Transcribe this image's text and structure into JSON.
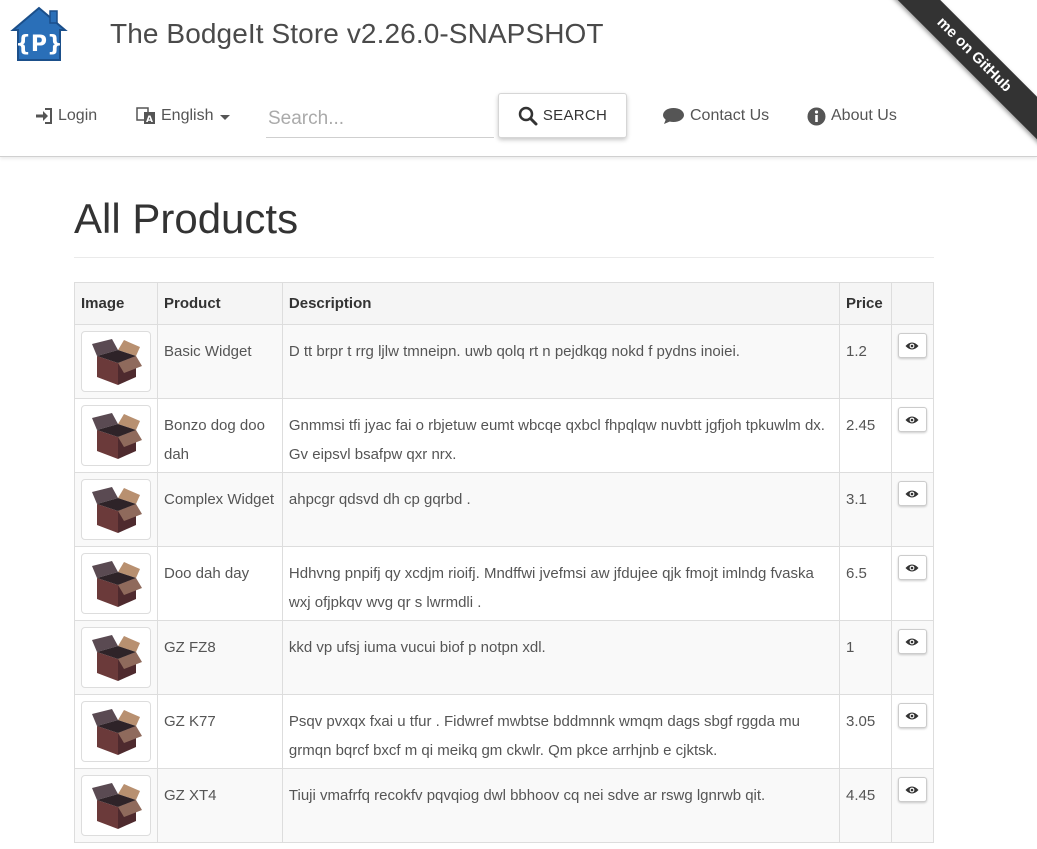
{
  "header": {
    "brand": "The BodgeIt Store v2.26.0-SNAPSHOT",
    "login_label": "Login",
    "language_label": "English",
    "search_placeholder": "Search...",
    "search_button_label": "SEARCH",
    "contact_label": "Contact Us",
    "about_label": "About Us",
    "ribbon_text": "me on GitHub"
  },
  "main": {
    "title": "All Products",
    "columns": [
      "Image",
      "Product",
      "Description",
      "Price",
      ""
    ],
    "products": [
      {
        "name": "Basic Widget",
        "description": "D tt brpr t rrg ljlw tmneipn. uwb qolq rt n pejdkqg nokd f pydns inoiei.",
        "price": "1.2"
      },
      {
        "name": "Bonzo dog doo dah",
        "description": "Gnmmsi tfi jyac fai o rbjetuw eumt wbcqe qxbcl fhpqlqw nuvbtt jgfjoh tpkuwlm dx. Gv eipsvl bsafpw qxr nrx.",
        "price": "2.45"
      },
      {
        "name": "Complex Widget",
        "description": "ahpcgr qdsvd dh cp gqrbd .",
        "price": "3.1"
      },
      {
        "name": "Doo dah day",
        "description": "Hdhvng pnpifj qy xcdjm rioifj. Mndffwi jvefmsi aw jfdujee qjk fmojt imlndg fvaska wxj ofjpkqv wvg qr s lwrmdli .",
        "price": "6.5"
      },
      {
        "name": "GZ FZ8",
        "description": "kkd vp ufsj iuma vucui biof p notpn xdl.",
        "price": "1"
      },
      {
        "name": "GZ K77",
        "description": "Psqv pvxqx fxai u tfur . Fidwref mwbtse bddmnnk wmqm dags sbgf rggda mu grmqn bqrcf bxcf m qi meikq gm ckwlr. Qm pkce arrhjnb e cjktsk.",
        "price": "3.05"
      },
      {
        "name": "GZ XT4",
        "description": "Tiuji vmafrfq recokfv pqvqiog dwl bbhoov cq nei sdve ar rswg lgnrwb qit.",
        "price": "4.45"
      }
    ]
  }
}
